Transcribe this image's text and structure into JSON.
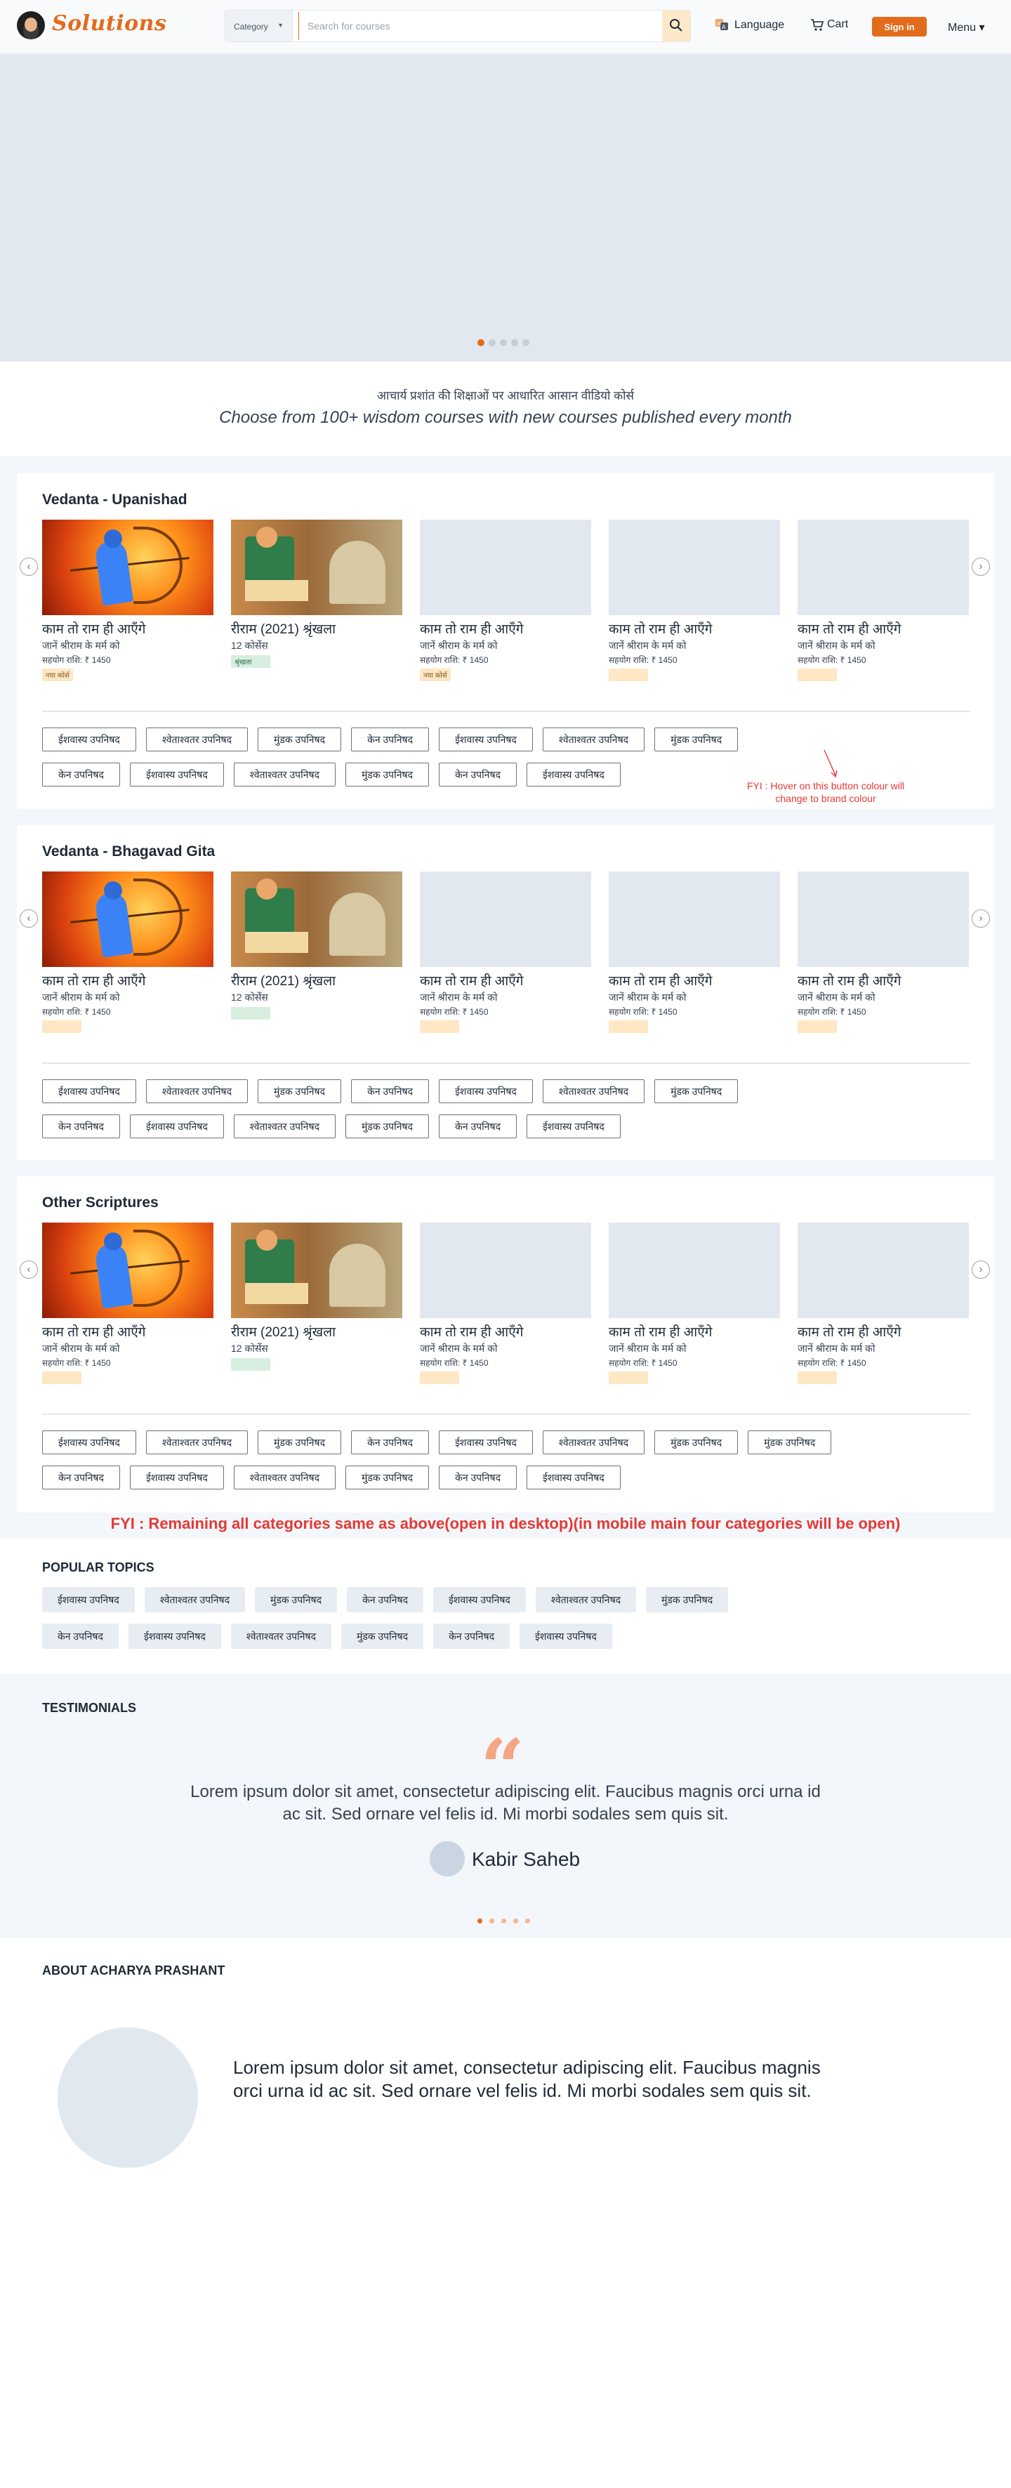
{
  "header": {
    "logo_text": "Solutions",
    "category_label": "Category",
    "search_placeholder": "Search for courses",
    "language_label": "Language",
    "cart_label": "Cart",
    "signin_label": "Sign in",
    "menu_label": "Menu"
  },
  "hero": {
    "slides": 5,
    "active_slide": 1
  },
  "intro": {
    "hindi": "आचार्य प्रशांत की शिक्षाओं पर आधारित आसान वीडियो कोर्स",
    "english": "Choose from 100+ wisdom courses with new courses published every month"
  },
  "sections": [
    {
      "title": "Vedanta - Upanishad",
      "cards": [
        {
          "title": "काम तो राम ही आएँगे",
          "subtitle": "जानें श्रीराम के मर्म को",
          "price": "सहयोग राशि: ₹ 1450",
          "badge": "नया कोर्स"
        },
        {
          "title": "रीराम (2021) श्रृंखला",
          "subtitle": "12 कोर्सेस",
          "price": "",
          "badge": "श्रृंखला"
        },
        {
          "title": "काम तो राम ही आएँगे",
          "subtitle": "जानें श्रीराम के मर्म को",
          "price": "सहयोग राशि: ₹ 1450",
          "badge": "नया कोर्स"
        },
        {
          "title": "काम तो राम ही आएँगे",
          "subtitle": "जानें श्रीराम के मर्म को",
          "price": "सहयोग राशि: ₹ 1450",
          "badge": ""
        },
        {
          "title": "काम तो राम ही आएँगे",
          "subtitle": "जानें श्रीराम के मर्म को",
          "price": "सहयोग राशि: ₹ 1450",
          "badge": ""
        }
      ],
      "tags_row1": [
        "ईशवास्य उपनिषद",
        "श्वेताश्वतर उपनिषद",
        "मुंडक उपनिषद",
        "केन उपनिषद",
        "ईशवास्य उपनिषद",
        "श्वेताश्वतर उपनिषद",
        "मुंडक उपनिषद"
      ],
      "tags_row2": [
        "केन उपनिषद",
        "ईशवास्य उपनिषद",
        "श्वेताश्वतर उपनिषद",
        "मुंडक उपनिषद",
        "केन उपनिषद",
        "ईशवास्य उपनिषद"
      ],
      "fyi": "FYI : Hover on this button colour will change to brand colour"
    },
    {
      "title": "Vedanta - Bhagavad Gita",
      "cards": [
        {
          "title": "काम तो राम ही आएँगे",
          "subtitle": "जानें श्रीराम के मर्म को",
          "price": "सहयोग राशि: ₹ 1450",
          "badge": ""
        },
        {
          "title": "रीराम (2021) श्रृंखला",
          "subtitle": "12 कोर्सेस",
          "price": "",
          "badge": ""
        },
        {
          "title": "काम तो राम ही आएँगे",
          "subtitle": "जानें श्रीराम के मर्म को",
          "price": "सहयोग राशि: ₹ 1450",
          "badge": ""
        },
        {
          "title": "काम तो राम ही आएँगे",
          "subtitle": "जानें श्रीराम के मर्म को",
          "price": "सहयोग राशि: ₹ 1450",
          "badge": ""
        },
        {
          "title": "काम तो राम ही आएँगे",
          "subtitle": "जानें श्रीराम के मर्म को",
          "price": "सहयोग राशि: ₹ 1450",
          "badge": ""
        }
      ],
      "tags_row1": [
        "ईशवास्य उपनिषद",
        "श्वेताश्वतर उपनिषद",
        "मुंडक उपनिषद",
        "केन उपनिषद",
        "ईशवास्य उपनिषद",
        "श्वेताश्वतर उपनिषद",
        "मुंडक उपनिषद"
      ],
      "tags_row2": [
        "केन उपनिषद",
        "ईशवास्य उपनिषद",
        "श्वेताश्वतर उपनिषद",
        "मुंडक उपनिषद",
        "केन उपनिषद",
        "ईशवास्य उपनिषद"
      ]
    },
    {
      "title": "Other Scriptures",
      "cards": [
        {
          "title": "काम तो राम ही आएँगे",
          "subtitle": "जानें श्रीराम के मर्म को",
          "price": "सहयोग राशि: ₹ 1450",
          "badge": ""
        },
        {
          "title": "रीराम (2021) श्रृंखला",
          "subtitle": "12 कोर्सेस",
          "price": "",
          "badge": ""
        },
        {
          "title": "काम तो राम ही आएँगे",
          "subtitle": "जानें श्रीराम के मर्म को",
          "price": "सहयोग राशि: ₹ 1450",
          "badge": ""
        },
        {
          "title": "काम तो राम ही आएँगे",
          "subtitle": "जानें श्रीराम के मर्म को",
          "price": "सहयोग राशि: ₹ 1450",
          "badge": ""
        },
        {
          "title": "काम तो राम ही आएँगे",
          "subtitle": "जानें श्रीराम के मर्म को",
          "price": "सहयोग राशि: ₹ 1450",
          "badge": ""
        }
      ],
      "tags_row1": [
        "ईशवास्य उपनिषद",
        "श्वेताश्वतर उपनिषद",
        "मुंडक उपनिषद",
        "केन उपनिषद",
        "ईशवास्य उपनिषद",
        "श्वेताश्वतर उपनिषद",
        "मुंडक उपनिषद",
        "मुंडक उपनिषद"
      ],
      "tags_row2": [
        "केन उपनिषद",
        "ईशवास्य उपनिषद",
        "श्वेताश्वतर उपनिषद",
        "मुंडक उपनिषद",
        "केन उपनिषद",
        "ईशवास्य उपनिषद"
      ]
    }
  ],
  "fyi_main": "FYI : Remaining all categories same as above(open in desktop)(in mobile main four categories will be open)",
  "popular_topics": {
    "title": "POPULAR TOPICS",
    "row1": [
      "ईशवास्य उपनिषद",
      "श्वेताश्वतर उपनिषद",
      "मुंडक उपनिषद",
      "केन उपनिषद",
      "ईशवास्य उपनिषद",
      "श्वेताश्वतर उपनिषद",
      "मुंडक उपनिषद"
    ],
    "row2": [
      "केन उपनिषद",
      "ईशवास्य उपनिषद",
      "श्वेताश्वतर उपनिषद",
      "मुंडक उपनिषद",
      "केन उपनिषद",
      "ईशवास्य उपनिषद"
    ]
  },
  "testimonials": {
    "title": "TESTIMONIALS",
    "quote": "Lorem ipsum dolor sit amet, consectetur adipiscing elit. Faucibus magnis orci urna id ac sit. Sed ornare vel felis id. Mi morbi sodales sem quis sit.",
    "author": "Kabir Saheb",
    "slides": 5,
    "active_slide": 1
  },
  "about": {
    "title": "ABOUT ACHARYA PRASHANT",
    "text": "Lorem ipsum dolor sit amet, consectetur adipiscing elit. Faucibus magnis orci urna id ac sit. Sed ornare vel felis id. Mi morbi sodales sem quis sit."
  },
  "colors": {
    "brand": "#e36b1c",
    "fyi": "#e53935",
    "placeholder": "#e2e8f0"
  }
}
